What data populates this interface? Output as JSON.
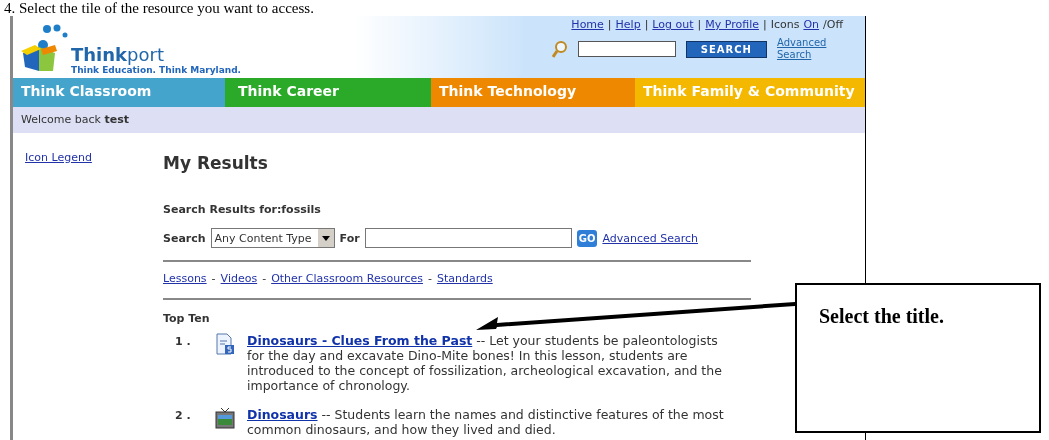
{
  "instruction": "4. Select the tile of the resource you want to access.",
  "logo": {
    "name": "**Think**port",
    "tagline": "Think Education. Think Maryland."
  },
  "top_links": [
    {
      "label": "Home"
    },
    {
      "label": "Help"
    },
    {
      "label": "Log out"
    },
    {
      "label": "My Profile"
    }
  ],
  "link_separator": "|",
  "icons_toggle": {
    "label": "Icons",
    "on": "On",
    "off": "/Off"
  },
  "header_search": {
    "button": "SEARCH",
    "advanced": "Advanced Search"
  },
  "nav_tabs": [
    {
      "label": "Think Classroom",
      "color": "#44a4cc"
    },
    {
      "label": "Think Career",
      "color": "#2aaa28"
    },
    {
      "label": "Think Technology",
      "color": "#ee8800"
    },
    {
      "label": "Think Family & Community",
      "color": "#f5b800"
    }
  ],
  "welcome": "Welcome back **test**",
  "sidebar": {
    "link": "Icon Legend"
  },
  "heading": "My Results",
  "results_for": "Search Results for:fossils",
  "search_form": {
    "label": "Search",
    "content_type": "Any Content Type",
    "for_label": "For",
    "go": "GO",
    "advanced": "Advanced Search"
  },
  "filters": [
    "Lessons",
    "Videos",
    "Other Classroom Resources",
    "Standards"
  ],
  "filter_separator": "-",
  "section": "Top Ten",
  "results": [
    {
      "number": "1 .",
      "kind": "lesson",
      "title": "Dinosaurs - Clues From the Past",
      "description": "-- Let your students be paleontologists for the day and excavate Dino-Mite bones! In this lesson, students are introduced to the concept of fossilization, archeological excavation, and the importance of chronology."
    },
    {
      "number": "2 .",
      "kind": "video",
      "title": "Dinosaurs",
      "description": "-- Students learn the names and distinctive features of the most common dinosaurs, and how they lived and died."
    }
  ],
  "callout": "Select the title."
}
